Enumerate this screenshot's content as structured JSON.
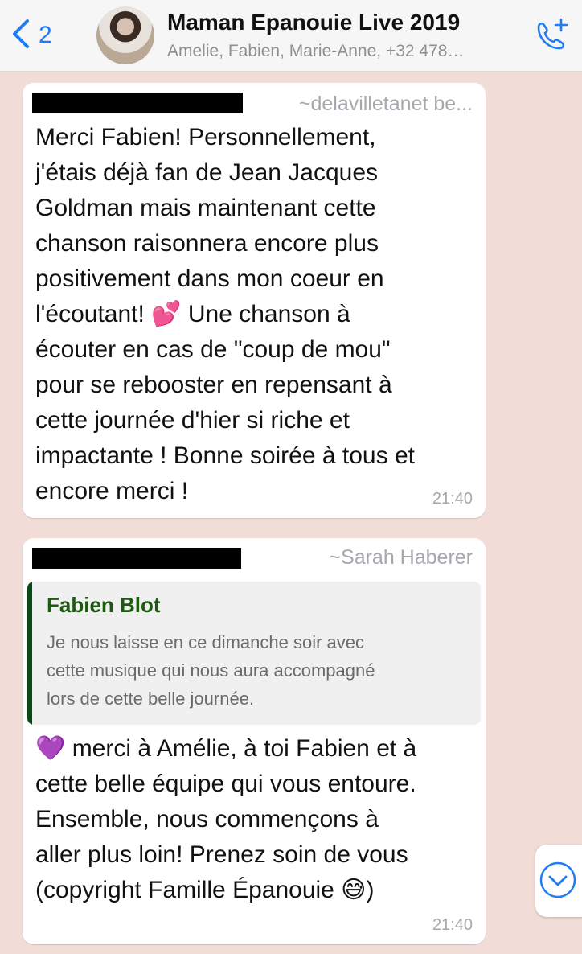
{
  "header": {
    "back_count": "2",
    "title": "Maman Epanouie Live 2019",
    "subtitle": "Amelie, Fabien, Marie-Anne, +32 478…"
  },
  "messages": [
    {
      "sender": "~delavilletanet be...",
      "lines": [
        "Merci Fabien! Personnellement,",
        "j'étais déjà fan de Jean Jacques",
        "Goldman mais maintenant cette",
        "chanson raisonnera encore plus",
        "positivement dans mon coeur en",
        "l'écoutant! 💕 Une chanson à",
        "écouter en cas de \"coup de mou\"",
        "pour se rebooster en repensant à",
        "cette journée d'hier si riche et",
        "impactante ! Bonne soirée à tous et",
        "encore merci !"
      ],
      "time": "21:40"
    },
    {
      "sender": "~Sarah Haberer",
      "quote": {
        "name": "Fabien Blot",
        "text_lines": [
          "Je nous laisse en ce dimanche soir avec",
          "cette musique qui nous aura accompagné",
          "lors de cette belle journée."
        ]
      },
      "lines": [
        "💜 merci à Amélie, à toi Fabien et à",
        "cette belle équipe qui vous entoure.",
        "Ensemble, nous commençons à",
        "aller plus loin! Prenez soin de vous",
        "(copyright Famille Épanouie 😅)"
      ],
      "time": "21:40"
    }
  ],
  "colors": {
    "accent": "#1f7cf6",
    "chat_background": "#f1dcd7",
    "quote_bar": "#0b4a16",
    "quote_name": "#1f5a12"
  },
  "icons": {
    "back": "chevron-left-icon",
    "call": "add-call-icon",
    "scroll": "chevron-down-circle-icon"
  }
}
